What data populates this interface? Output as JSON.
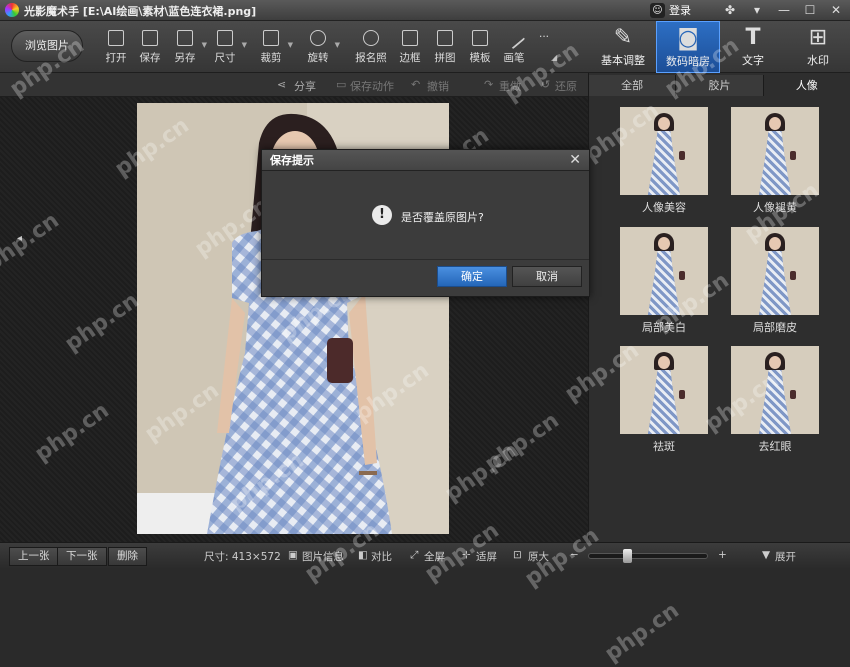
{
  "window": {
    "title": "光影魔术手 [E:\\AI绘画\\素材\\蓝色连衣裙.png]",
    "login_label": "登录"
  },
  "toolbar": {
    "browse_label": "浏览图片",
    "tools": [
      {
        "label": "打开",
        "icon": "open-icon"
      },
      {
        "label": "保存",
        "icon": "save-icon"
      },
      {
        "label": "另存",
        "icon": "save-as-icon"
      },
      {
        "label": "尺寸",
        "icon": "resize-icon"
      },
      {
        "label": "裁剪",
        "icon": "crop-icon"
      },
      {
        "label": "旋转",
        "icon": "rotate-icon"
      },
      {
        "label": "报名照",
        "icon": "id-photo-icon"
      },
      {
        "label": "边框",
        "icon": "frame-icon"
      },
      {
        "label": "拼图",
        "icon": "collage-icon"
      },
      {
        "label": "模板",
        "icon": "template-icon"
      },
      {
        "label": "画笔",
        "icon": "brush-icon"
      }
    ],
    "more_label": "···",
    "right_tabs": [
      {
        "label": "基本调整",
        "icon": "basic-adjust-icon"
      },
      {
        "label": "数码暗房",
        "icon": "camera-icon"
      },
      {
        "label": "文字",
        "icon": "text-icon"
      },
      {
        "label": "水印",
        "icon": "watermark-icon"
      }
    ]
  },
  "secondbar": {
    "share": "分享",
    "save_action": "保存动作",
    "undo": "撤销",
    "redo": "重做",
    "restore": "还原"
  },
  "panel": {
    "tabs": [
      "全部",
      "胶片",
      "人像"
    ],
    "items": [
      "人像美容",
      "人像褪黄",
      "局部美白",
      "局部磨皮",
      "祛斑",
      "去红眼"
    ]
  },
  "dialog": {
    "title": "保存提示",
    "message": "是否覆盖原图片?",
    "ok": "确定",
    "cancel": "取消"
  },
  "bottombar": {
    "prev": "上一张",
    "next": "下一张",
    "delete": "删除",
    "size": "尺寸: 413×572",
    "info": "图片信息",
    "compare": "对比",
    "fullscreen": "全屏",
    "fit": "适屏",
    "original": "原大",
    "expand": "展开",
    "zoom_minus": "−",
    "zoom_plus": "+"
  },
  "zoom_level": 0.3,
  "watermark_text": "php.cn"
}
